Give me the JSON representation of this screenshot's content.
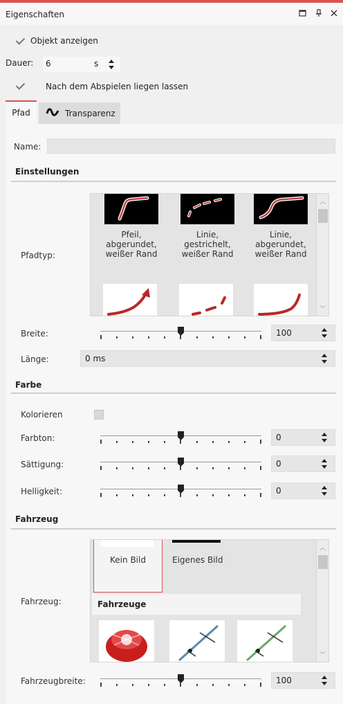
{
  "window": {
    "title": "Eigenschaften",
    "icons": {
      "restore": "restore-icon",
      "pin": "pin-icon",
      "close": "close-icon"
    }
  },
  "show_object": {
    "label": "Objekt anzeigen",
    "checked": true
  },
  "duration": {
    "label": "Dauer:",
    "value": "6",
    "unit": "s"
  },
  "stay_after_play": {
    "label": "Nach dem Abspielen liegen lassen",
    "checked": true
  },
  "tabs": [
    {
      "label": "Pfad",
      "active": true
    },
    {
      "label": "Transparenz",
      "active": false,
      "icon": "wave-icon"
    }
  ],
  "name_field": {
    "label": "Name:",
    "value": ""
  },
  "sections": {
    "settings": "Einstellungen",
    "color": "Farbe",
    "vehicle": "Fahrzeug"
  },
  "path_type": {
    "label": "Pfadtyp:",
    "options": [
      {
        "line1": "Pfeil,",
        "line2": "abgerundet,",
        "line3": "weißer Rand"
      },
      {
        "line1": "Linie,",
        "line2": "gestrichelt,",
        "line3": "weißer Rand"
      },
      {
        "line1": "Linie,",
        "line2": "abgerundet,",
        "line3": "weißer Rand"
      }
    ]
  },
  "width": {
    "label": "Breite:",
    "value": "100",
    "slider_fraction": 0.5
  },
  "length": {
    "label": "Länge:",
    "value": "0 ms"
  },
  "colorize": {
    "label": "Kolorieren",
    "checked": false
  },
  "hue": {
    "label": "Farbton:",
    "value": "0",
    "slider_fraction": 0.5
  },
  "saturation": {
    "label": "Sättigung:",
    "value": "0",
    "slider_fraction": 0.5
  },
  "brightness": {
    "label": "Helligkeit:",
    "value": "0",
    "slider_fraction": 0.5
  },
  "vehicle": {
    "label": "Fahrzeug:",
    "no_image": "Kein Bild",
    "own_image": "Eigenes Bild",
    "group_header": "Fahrzeuge"
  },
  "vehicle_width": {
    "label": "Fahrzeugbreite:",
    "value": "100",
    "slider_fraction": 0.5
  },
  "colors": {
    "accent": "#d9534f",
    "path_red": "#b82828"
  }
}
